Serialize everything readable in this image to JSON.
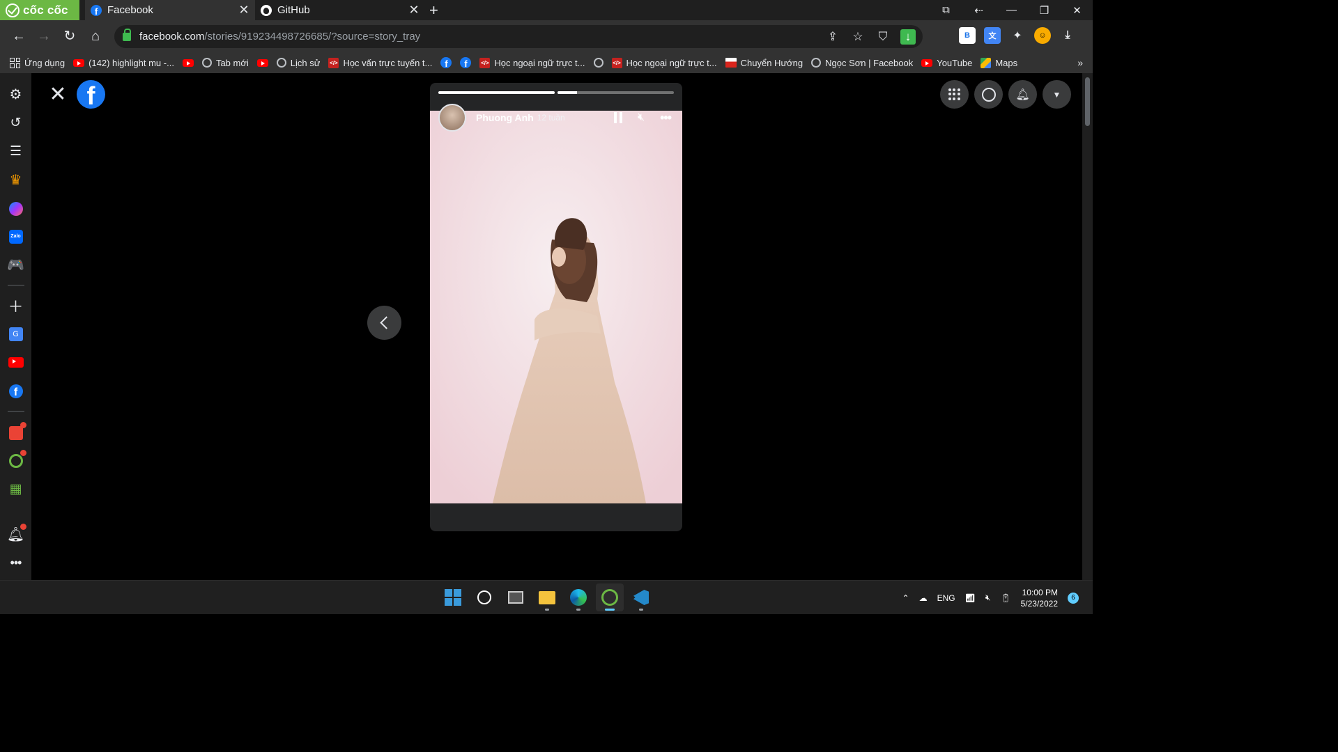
{
  "browser": {
    "brand": "cốc cốc",
    "tabs": [
      {
        "title": "Facebook",
        "close": "✕"
      },
      {
        "title": "GitHub",
        "close": "✕"
      }
    ],
    "new_tab": "+",
    "url_host": "facebook.com",
    "url_path": "/stories/919234498726685/?source=story_tray",
    "ext_b_label": "B"
  },
  "bookmarks": [
    {
      "label": "Ứng dụng",
      "icon": "apps-grid-icon"
    },
    {
      "label": "(142) highlight mu -...",
      "icon": "youtube-icon"
    },
    {
      "label": "",
      "icon": "youtube-icon"
    },
    {
      "label": "Tab mới",
      "icon": "globe-icon"
    },
    {
      "label": "",
      "icon": "youtube-icon"
    },
    {
      "label": "Lịch sử",
      "icon": "history-icon"
    },
    {
      "label": "Học vấn trực tuyến t...",
      "icon": "code-icon"
    },
    {
      "label": "",
      "icon": "facebook-icon"
    },
    {
      "label": "",
      "icon": "facebook-icon"
    },
    {
      "label": "Học ngoại ngữ trực t...",
      "icon": "code-icon"
    },
    {
      "label": "",
      "icon": "globe-icon"
    },
    {
      "label": "Học ngoại ngữ trực t...",
      "icon": "code-icon"
    },
    {
      "label": "Chuyển Hướng",
      "icon": "flag-icon"
    },
    {
      "label": "Ngọc Sơn | Facebook",
      "icon": "globe-icon"
    },
    {
      "label": "YouTube",
      "icon": "youtube-icon"
    },
    {
      "label": "Maps",
      "icon": "maps-icon"
    }
  ],
  "bookmarks_more": "»",
  "story": {
    "user_name": "Phuong Anh",
    "time_ago": "12 tuần",
    "progress": [
      1.0,
      0.17
    ]
  },
  "taskbar": {
    "language": "ENG",
    "time": "10:00 PM",
    "date": "5/23/2022",
    "notification_count": "6"
  },
  "colors": {
    "brand_green": "#6cb844",
    "facebook_blue": "#1877f2",
    "accent_taskbar": "#60cdff"
  }
}
